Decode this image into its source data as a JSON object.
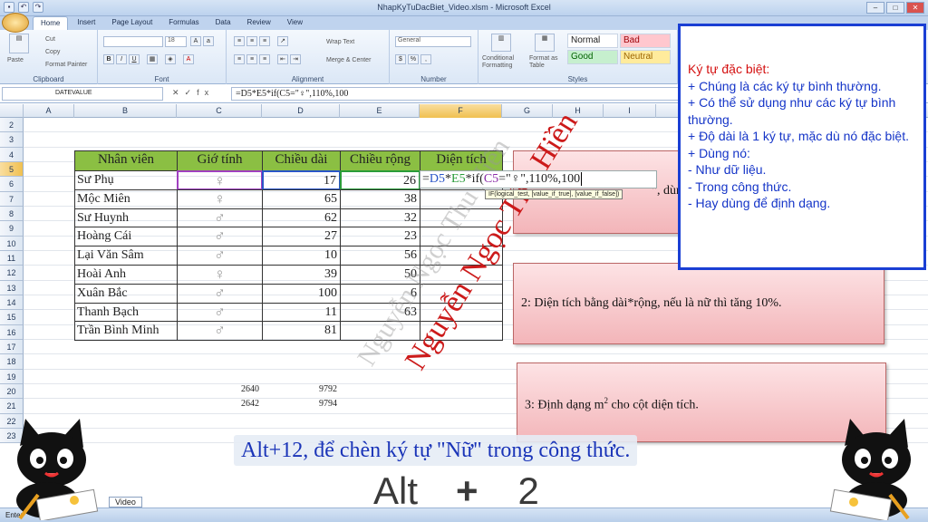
{
  "window": {
    "title": "NhapKyTuDacBiet_Video.xlsm - Microsoft Excel"
  },
  "ribbon": {
    "tabs": [
      "Home",
      "Insert",
      "Page Layout",
      "Formulas",
      "Data",
      "Review",
      "View"
    ],
    "clipboard": {
      "paste": "Paste",
      "cut": "Cut",
      "copy": "Copy",
      "format_painter": "Format Painter",
      "label": "Clipboard"
    },
    "font": {
      "size": "18",
      "label": "Font"
    },
    "alignment": {
      "wrap": "Wrap Text",
      "merge": "Merge & Center",
      "label": "Alignment"
    },
    "number": {
      "format": "General",
      "label": "Number"
    },
    "styles": {
      "conditional": "Conditional Formatting",
      "as_table": "Format as Table",
      "normal": "Normal",
      "bad": "Bad",
      "good": "Good",
      "neutral": "Neutral",
      "label": "Styles"
    }
  },
  "formula_bar": {
    "name_box": "DATEVALUE",
    "formula": "=D5*E5*if(C5=\"♀\",110%,100"
  },
  "columns": [
    "A",
    "B",
    "C",
    "D",
    "E",
    "F",
    "G",
    "H",
    "I"
  ],
  "rows": [
    "2",
    "3",
    "4",
    "5",
    "6",
    "7",
    "8",
    "9",
    "10",
    "11",
    "12",
    "13",
    "14",
    "15",
    "16",
    "17",
    "18",
    "19",
    "20",
    "21",
    "22",
    "23"
  ],
  "table": {
    "headers": [
      "Nhân viên",
      "Giớ tính",
      "Chiều dài",
      "Chiều rộng",
      "Diện tích"
    ],
    "data": [
      {
        "name": "Sư Phụ",
        "gender": "♀",
        "length": "17",
        "width": "26"
      },
      {
        "name": "Mộc Miên",
        "gender": "♀",
        "length": "65",
        "width": "38"
      },
      {
        "name": "Sư Huynh",
        "gender": "♂",
        "length": "62",
        "width": "32"
      },
      {
        "name": "Hoàng Cái",
        "gender": "♂",
        "length": "27",
        "width": "23"
      },
      {
        "name": "Lại Văn Sâm",
        "gender": "♂",
        "length": "10",
        "width": "56"
      },
      {
        "name": "Hoài Anh",
        "gender": "♀",
        "length": "39",
        "width": "50"
      },
      {
        "name": "Xuân Bắc",
        "gender": "♂",
        "length": "100",
        "width": "6"
      },
      {
        "name": "Thanh Bạch",
        "gender": "♂",
        "length": "11",
        "width": "63"
      },
      {
        "name": "Trần Bình Minh",
        "gender": "♂",
        "length": "81",
        "width": ""
      }
    ]
  },
  "extra_cells": {
    "r17c": "2640",
    "r17d": "9792",
    "r18c": "2642",
    "r18d": "9794"
  },
  "inline_edit": {
    "p1": "=",
    "p2": "D5",
    "p3": "*",
    "p4": "E5",
    "p5": "*if(",
    "p6": "C5",
    "p7": "=\"♀\",110%,100"
  },
  "tooltip": {
    "text": "IF(logical_test, [value_if_true], [value_if_false])"
  },
  "notes": {
    "note1_tail": "\", dùn",
    "note2": "2: Diện tích bằng dài*rộng, nếu là nữ thì tăng 10%.",
    "note3_a": "3: Định dạng m",
    "note3_sup": "2",
    "note3_b": " cho cột diện tích."
  },
  "info_box": {
    "title": "Ký tự đặc biệt:",
    "lines": [
      "+ Chúng là các ký tự bình thường.",
      "+ Có thể sử dụng như các ký tự bình thường.",
      "+ Độ dài là 1 ký tự, mặc dù nó đặc biệt.",
      "+ Dùng nó:",
      "- Như dữ liệu.",
      "- Trong công thức.",
      "- Hay dùng để định dạng."
    ]
  },
  "watermark": {
    "author": "Nguyễn Ngọc Thu Hiền",
    "shadow": "Nguyễn Ngọc Thu Hiền"
  },
  "caption": {
    "text": "Alt+12, để chèn ký tự \"Nữ\" trong công thức."
  },
  "keys": {
    "k1": "Alt",
    "k2": "+",
    "k3": "2"
  },
  "status": {
    "mode": "Enter",
    "sheet": "Video"
  },
  "colors": {
    "header_green": "#8bbf43",
    "info_border": "#1a3fd4",
    "info_text": "#1535c8",
    "info_title": "#d41010",
    "watermark": "#cc1a1a"
  }
}
